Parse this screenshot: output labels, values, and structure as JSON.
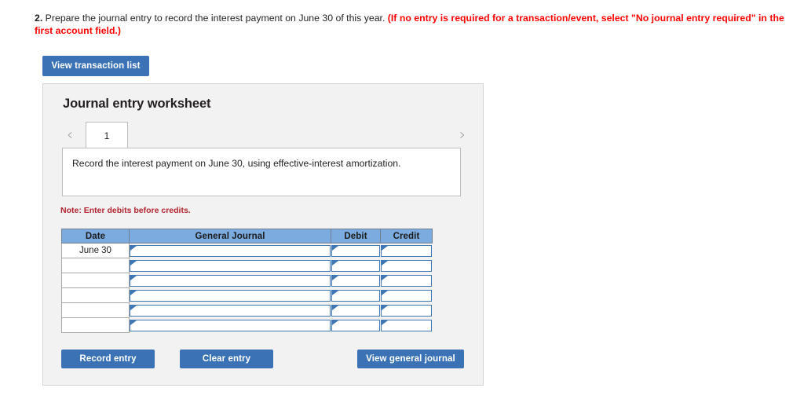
{
  "question": {
    "number": "2.",
    "text": " Prepare the journal entry to record the interest payment on June 30 of this year. ",
    "hint": "(If no entry is required for a transaction/event, select \"No journal entry required\" in the first account field.)"
  },
  "toolbar": {
    "view_transaction_list_label": "View transaction list"
  },
  "worksheet": {
    "title": "Journal entry worksheet",
    "tabs": [
      {
        "label": "1",
        "active": true
      }
    ],
    "prev_icon": "chevron-left-icon",
    "next_icon": "chevron-right-icon",
    "prev_glyph": "‹",
    "next_glyph": "›",
    "description": "Record the interest payment on June 30, using effective-interest amortization.",
    "note": "Note: Enter debits before credits."
  },
  "table": {
    "headers": [
      "Date",
      "General Journal",
      "Debit",
      "Credit"
    ],
    "rows": [
      {
        "date": "June 30",
        "general_journal": "",
        "debit": "",
        "credit": ""
      },
      {
        "date": "",
        "general_journal": "",
        "debit": "",
        "credit": ""
      },
      {
        "date": "",
        "general_journal": "",
        "debit": "",
        "credit": ""
      },
      {
        "date": "",
        "general_journal": "",
        "debit": "",
        "credit": ""
      },
      {
        "date": "",
        "general_journal": "",
        "debit": "",
        "credit": ""
      },
      {
        "date": "",
        "general_journal": "",
        "debit": "",
        "credit": ""
      }
    ]
  },
  "actions": {
    "record_entry_label": "Record entry",
    "clear_entry_label": "Clear entry",
    "view_general_journal_label": "View general journal"
  },
  "colors": {
    "button_blue": "#3a72b5",
    "table_header_blue": "#7cabdf",
    "input_border_blue": "#3f77b4",
    "hint_red": "#ff0000",
    "note_red": "#b32430",
    "panel_gray": "#f2f2f2"
  }
}
